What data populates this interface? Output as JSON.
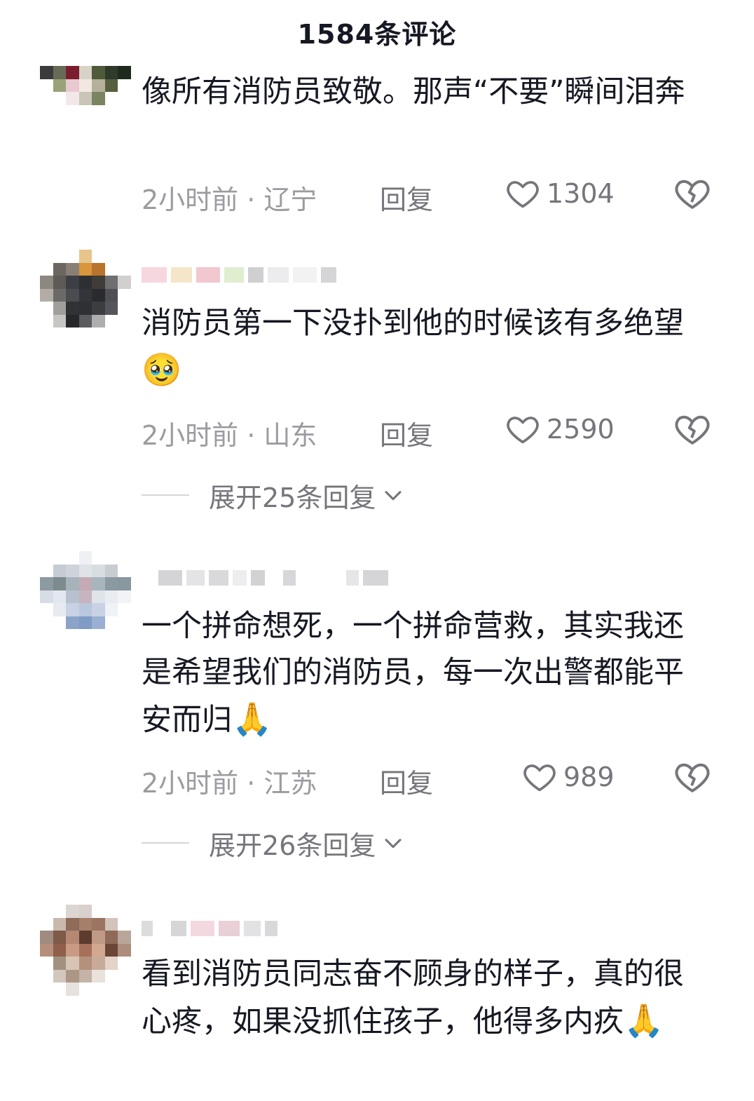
{
  "header": {
    "title": "1584条评论"
  },
  "colors": {
    "text": "#161823",
    "meta": "#9b9ba1",
    "action": "#75757c",
    "divider": "#d6d6d9"
  },
  "comments": [
    {
      "text": "像所有消防员致敬。那声“不要”瞬间泪奔",
      "emoji": "",
      "time_location": "2小时前 · 辽宁",
      "reply_label": "回复",
      "likes": "1304"
    },
    {
      "text": "消防员第一下没扑到他的时候该有多绝望",
      "emoji": "🥹",
      "time_location": "2小时前 · 山东",
      "reply_label": "回复",
      "likes": "2590",
      "expand_label": "展开25条回复"
    },
    {
      "text": "一个拼命想死，一个拼命营救，其实我还是希望我们的消防员，每一次出警都能平安而归",
      "emoji": "🙏",
      "time_location": "2小时前 · 江苏",
      "reply_label": "回复",
      "likes": "989",
      "expand_label": "展开26条回复"
    },
    {
      "text": "看到消防员同志奋不顾身的样子，真的很心疼，如果没抓住孩子，他得多内疚",
      "emoji": "🙏",
      "time_location": "",
      "reply_label": "",
      "likes": ""
    }
  ],
  "icons": {
    "like": "heart-outline-icon",
    "dislike": "broken-heart-icon",
    "expand": "chevron-down-icon"
  }
}
